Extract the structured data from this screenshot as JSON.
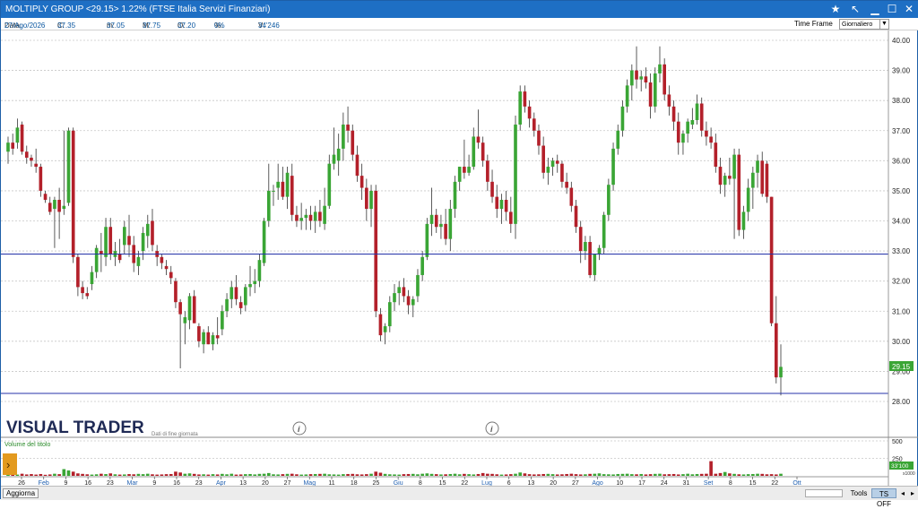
{
  "window": {
    "title": "MOLTIPLY GROUP <29.15> 1.22% (FTSE Italia Servizi Finanziari)",
    "star_icon": "star-icon",
    "pointer_icon": "arrow-pointer-icon"
  },
  "info": {
    "data_label": "Data:",
    "data_value": "27/Ago/2026",
    "c_label": "C:",
    "c_value": "37.35",
    "m_label": "m:",
    "m_value": "37.05",
    "M_label": "M:",
    "M_value": "37.75",
    "o_label": "O:",
    "o_value": "37.20",
    "pct_label": "%:",
    "pct_value": "0%",
    "v_label": "V:",
    "v_value": "34'246"
  },
  "timeframe": {
    "label": "Time Frame",
    "selected": "Giornaliero"
  },
  "chart": {
    "logo": "VISUAL TRADER",
    "logo_sub": "Dati di fine giornata",
    "volume_title": "Volume del titolo",
    "last_price_tag": "29.15",
    "volume_tag": "33'100",
    "volume_unit": "x1000"
  },
  "bottom": {
    "refresh": "Aggiorna",
    "tools": "Tools",
    "tsoff": "TS OFF"
  },
  "colors": {
    "up": "#3aa535",
    "down": "#b3202a",
    "reference_line": "#2433a8",
    "titlebar": "#1e6fc4"
  },
  "chart_data": {
    "type": "candlestick",
    "y_axis_ticks": [
      "28.00",
      "29.00",
      "30.00",
      "31.00",
      "32.00",
      "33.00",
      "34.00",
      "35.00",
      "36.00",
      "37.00",
      "38.00",
      "39.00",
      "40.00"
    ],
    "ylim": [
      28,
      40.1
    ],
    "reference_line": 32.9,
    "volume_ticks": [
      "250",
      "500"
    ],
    "x_tick_labels": [
      "26",
      "Feb",
      "9",
      "16",
      "23",
      "Mar",
      "9",
      "16",
      "23",
      "Apr",
      "13",
      "20",
      "27",
      "Mag",
      "11",
      "18",
      "25",
      "Giu",
      "8",
      "15",
      "22",
      "Lug",
      "6",
      "13",
      "20",
      "27",
      "Ago",
      "10",
      "17",
      "24",
      "31",
      "Set",
      "8",
      "15",
      "22",
      "Ott"
    ],
    "ohlc": [
      {
        "o": 36.3,
        "h": 36.8,
        "l": 35.9,
        "c": 36.6
      },
      {
        "o": 36.6,
        "h": 36.9,
        "l": 36.2,
        "c": 36.4
      },
      {
        "o": 36.6,
        "h": 37.4,
        "l": 36.4,
        "c": 37.1
      },
      {
        "o": 37.2,
        "h": 37.3,
        "l": 36.2,
        "c": 36.3
      },
      {
        "o": 36.3,
        "h": 36.5,
        "l": 35.9,
        "c": 36.1
      },
      {
        "o": 36.1,
        "h": 36.2,
        "l": 35.8,
        "c": 36.0
      },
      {
        "o": 35.9,
        "h": 36.4,
        "l": 35.6,
        "c": 35.8
      },
      {
        "o": 35.8,
        "h": 35.9,
        "l": 34.8,
        "c": 35.0
      },
      {
        "o": 34.9,
        "h": 35.0,
        "l": 34.6,
        "c": 34.7
      },
      {
        "o": 34.6,
        "h": 34.8,
        "l": 34.2,
        "c": 34.3
      },
      {
        "o": 34.4,
        "h": 34.8,
        "l": 33.1,
        "c": 34.7
      },
      {
        "o": 34.7,
        "h": 35.1,
        "l": 33.4,
        "c": 34.3
      },
      {
        "o": 34.4,
        "h": 37.0,
        "l": 34.2,
        "c": 34.5
      },
      {
        "o": 34.6,
        "h": 37.1,
        "l": 34.5,
        "c": 37.0
      },
      {
        "o": 37.0,
        "h": 37.1,
        "l": 32.6,
        "c": 32.8
      },
      {
        "o": 32.8,
        "h": 32.9,
        "l": 31.5,
        "c": 31.8
      },
      {
        "o": 31.8,
        "h": 32.0,
        "l": 31.4,
        "c": 31.6
      },
      {
        "o": 31.6,
        "h": 31.8,
        "l": 31.4,
        "c": 31.5
      },
      {
        "o": 31.9,
        "h": 32.5,
        "l": 31.7,
        "c": 32.3
      },
      {
        "o": 32.3,
        "h": 33.2,
        "l": 32.1,
        "c": 33.1
      },
      {
        "o": 33.0,
        "h": 33.6,
        "l": 32.3,
        "c": 32.9
      },
      {
        "o": 32.8,
        "h": 34.1,
        "l": 32.5,
        "c": 33.8
      },
      {
        "o": 33.8,
        "h": 34.1,
        "l": 32.7,
        "c": 32.9
      },
      {
        "o": 32.8,
        "h": 33.3,
        "l": 32.5,
        "c": 33.0
      },
      {
        "o": 32.9,
        "h": 33.4,
        "l": 32.6,
        "c": 32.7
      },
      {
        "o": 33.2,
        "h": 34.0,
        "l": 32.9,
        "c": 33.8
      },
      {
        "o": 33.5,
        "h": 34.2,
        "l": 32.8,
        "c": 33.2
      },
      {
        "o": 33.2,
        "h": 33.5,
        "l": 32.3,
        "c": 32.6
      },
      {
        "o": 32.5,
        "h": 33.0,
        "l": 32.2,
        "c": 32.8
      },
      {
        "o": 33.0,
        "h": 33.8,
        "l": 32.7,
        "c": 33.6
      },
      {
        "o": 33.5,
        "h": 34.2,
        "l": 33.1,
        "c": 33.9
      },
      {
        "o": 34.0,
        "h": 34.4,
        "l": 33.0,
        "c": 33.2
      },
      {
        "o": 33.0,
        "h": 33.2,
        "l": 32.5,
        "c": 32.8
      },
      {
        "o": 32.8,
        "h": 32.9,
        "l": 32.4,
        "c": 32.6
      },
      {
        "o": 32.5,
        "h": 32.7,
        "l": 32.2,
        "c": 32.4
      },
      {
        "o": 32.3,
        "h": 32.5,
        "l": 31.9,
        "c": 32.1
      },
      {
        "o": 32.0,
        "h": 32.1,
        "l": 31.1,
        "c": 31.3
      },
      {
        "o": 31.3,
        "h": 31.4,
        "l": 29.1,
        "c": 30.9
      },
      {
        "o": 30.6,
        "h": 31.0,
        "l": 29.9,
        "c": 30.8
      },
      {
        "o": 30.7,
        "h": 31.6,
        "l": 30.4,
        "c": 31.5
      },
      {
        "o": 31.5,
        "h": 31.7,
        "l": 30.6,
        "c": 30.6
      },
      {
        "o": 30.5,
        "h": 30.6,
        "l": 29.8,
        "c": 30.0
      },
      {
        "o": 29.9,
        "h": 30.4,
        "l": 29.6,
        "c": 30.3
      },
      {
        "o": 30.3,
        "h": 30.5,
        "l": 29.9,
        "c": 29.9
      },
      {
        "o": 29.9,
        "h": 30.3,
        "l": 29.7,
        "c": 30.2
      },
      {
        "o": 30.2,
        "h": 30.8,
        "l": 29.9,
        "c": 30.1
      },
      {
        "o": 30.4,
        "h": 31.2,
        "l": 30.2,
        "c": 31.0
      },
      {
        "o": 31.0,
        "h": 31.6,
        "l": 30.8,
        "c": 31.4
      },
      {
        "o": 31.4,
        "h": 32.0,
        "l": 31.1,
        "c": 31.8
      },
      {
        "o": 31.8,
        "h": 32.2,
        "l": 31.2,
        "c": 31.4
      },
      {
        "o": 31.3,
        "h": 31.5,
        "l": 30.9,
        "c": 31.1
      },
      {
        "o": 31.2,
        "h": 31.9,
        "l": 31.0,
        "c": 31.8
      },
      {
        "o": 31.8,
        "h": 32.5,
        "l": 31.5,
        "c": 31.9
      },
      {
        "o": 31.9,
        "h": 32.4,
        "l": 31.6,
        "c": 32.0
      },
      {
        "o": 32.0,
        "h": 32.9,
        "l": 31.8,
        "c": 32.7
      },
      {
        "o": 32.6,
        "h": 34.1,
        "l": 32.5,
        "c": 34.0
      },
      {
        "o": 34.0,
        "h": 35.9,
        "l": 33.8,
        "c": 35.0
      },
      {
        "o": 35.0,
        "h": 35.2,
        "l": 34.5,
        "c": 35.0
      },
      {
        "o": 35.1,
        "h": 35.9,
        "l": 34.7,
        "c": 35.3
      },
      {
        "o": 35.3,
        "h": 35.8,
        "l": 34.7,
        "c": 34.8
      },
      {
        "o": 34.8,
        "h": 35.8,
        "l": 34.4,
        "c": 35.6
      },
      {
        "o": 35.5,
        "h": 35.9,
        "l": 34.0,
        "c": 34.2
      },
      {
        "o": 34.2,
        "h": 34.5,
        "l": 33.8,
        "c": 34.0
      },
      {
        "o": 34.0,
        "h": 34.6,
        "l": 33.7,
        "c": 34.1
      },
      {
        "o": 34.1,
        "h": 34.4,
        "l": 33.7,
        "c": 34.2
      },
      {
        "o": 34.2,
        "h": 34.5,
        "l": 33.7,
        "c": 34.0
      },
      {
        "o": 34.0,
        "h": 34.5,
        "l": 33.6,
        "c": 34.3
      },
      {
        "o": 34.3,
        "h": 34.7,
        "l": 33.8,
        "c": 34.0
      },
      {
        "o": 33.9,
        "h": 35.1,
        "l": 33.7,
        "c": 34.5
      },
      {
        "o": 34.5,
        "h": 36.2,
        "l": 34.4,
        "c": 35.9
      },
      {
        "o": 35.9,
        "h": 37.1,
        "l": 35.7,
        "c": 36.2
      },
      {
        "o": 36.0,
        "h": 36.9,
        "l": 35.5,
        "c": 36.4
      },
      {
        "o": 36.4,
        "h": 37.6,
        "l": 36.0,
        "c": 37.2
      },
      {
        "o": 37.2,
        "h": 37.8,
        "l": 36.6,
        "c": 37.0
      },
      {
        "o": 37.0,
        "h": 37.2,
        "l": 36.0,
        "c": 36.2
      },
      {
        "o": 36.2,
        "h": 36.5,
        "l": 35.3,
        "c": 35.5
      },
      {
        "o": 35.5,
        "h": 35.9,
        "l": 34.7,
        "c": 35.1
      },
      {
        "o": 35.1,
        "h": 35.4,
        "l": 34.0,
        "c": 34.4
      },
      {
        "o": 34.4,
        "h": 35.2,
        "l": 33.8,
        "c": 35.0
      },
      {
        "o": 35.0,
        "h": 35.2,
        "l": 30.8,
        "c": 31.0
      },
      {
        "o": 30.9,
        "h": 31.1,
        "l": 30.0,
        "c": 30.2
      },
      {
        "o": 30.3,
        "h": 30.6,
        "l": 29.9,
        "c": 30.5
      },
      {
        "o": 30.5,
        "h": 31.5,
        "l": 30.3,
        "c": 31.3
      },
      {
        "o": 31.3,
        "h": 31.9,
        "l": 31.0,
        "c": 31.6
      },
      {
        "o": 31.6,
        "h": 32.0,
        "l": 31.2,
        "c": 31.8
      },
      {
        "o": 31.8,
        "h": 32.1,
        "l": 31.3,
        "c": 31.5
      },
      {
        "o": 31.5,
        "h": 31.7,
        "l": 30.9,
        "c": 31.2
      },
      {
        "o": 31.2,
        "h": 31.5,
        "l": 30.8,
        "c": 31.4
      },
      {
        "o": 31.5,
        "h": 32.4,
        "l": 31.3,
        "c": 32.2
      },
      {
        "o": 32.2,
        "h": 33.0,
        "l": 32.0,
        "c": 32.8
      },
      {
        "o": 32.8,
        "h": 34.1,
        "l": 32.7,
        "c": 33.9
      },
      {
        "o": 33.9,
        "h": 35.1,
        "l": 33.5,
        "c": 34.2
      },
      {
        "o": 34.2,
        "h": 34.4,
        "l": 33.6,
        "c": 33.8
      },
      {
        "o": 33.8,
        "h": 34.2,
        "l": 33.4,
        "c": 33.9
      },
      {
        "o": 33.9,
        "h": 34.4,
        "l": 33.2,
        "c": 33.4
      },
      {
        "o": 33.4,
        "h": 34.7,
        "l": 33.0,
        "c": 34.4
      },
      {
        "o": 34.4,
        "h": 35.5,
        "l": 34.1,
        "c": 35.3
      },
      {
        "o": 35.3,
        "h": 35.8,
        "l": 35.0,
        "c": 35.8
      },
      {
        "o": 35.8,
        "h": 36.7,
        "l": 35.4,
        "c": 35.6
      },
      {
        "o": 35.6,
        "h": 36.2,
        "l": 35.5,
        "c": 35.8
      },
      {
        "o": 35.8,
        "h": 37.1,
        "l": 35.7,
        "c": 36.8
      },
      {
        "o": 36.8,
        "h": 37.7,
        "l": 36.4,
        "c": 36.6
      },
      {
        "o": 36.6,
        "h": 36.8,
        "l": 35.8,
        "c": 36.0
      },
      {
        "o": 36.0,
        "h": 36.2,
        "l": 35.0,
        "c": 35.3
      },
      {
        "o": 35.3,
        "h": 35.7,
        "l": 34.6,
        "c": 34.8
      },
      {
        "o": 34.8,
        "h": 35.2,
        "l": 34.1,
        "c": 34.4
      },
      {
        "o": 34.4,
        "h": 34.9,
        "l": 33.9,
        "c": 34.7
      },
      {
        "o": 34.7,
        "h": 35.0,
        "l": 34.0,
        "c": 34.3
      },
      {
        "o": 34.3,
        "h": 34.8,
        "l": 33.6,
        "c": 33.9
      },
      {
        "o": 33.9,
        "h": 37.5,
        "l": 33.4,
        "c": 37.2
      },
      {
        "o": 37.2,
        "h": 38.5,
        "l": 37.0,
        "c": 38.3
      },
      {
        "o": 38.3,
        "h": 38.5,
        "l": 37.6,
        "c": 37.8
      },
      {
        "o": 37.8,
        "h": 38.0,
        "l": 37.1,
        "c": 37.4
      },
      {
        "o": 37.4,
        "h": 37.6,
        "l": 36.8,
        "c": 37.0
      },
      {
        "o": 37.0,
        "h": 37.2,
        "l": 36.2,
        "c": 36.5
      },
      {
        "o": 36.5,
        "h": 36.8,
        "l": 35.4,
        "c": 35.6
      },
      {
        "o": 35.6,
        "h": 36.1,
        "l": 35.2,
        "c": 35.8
      },
      {
        "o": 35.8,
        "h": 36.1,
        "l": 35.5,
        "c": 36.0
      },
      {
        "o": 36.0,
        "h": 36.2,
        "l": 35.6,
        "c": 35.9
      },
      {
        "o": 35.9,
        "h": 36.0,
        "l": 35.1,
        "c": 35.3
      },
      {
        "o": 35.3,
        "h": 35.6,
        "l": 34.9,
        "c": 35.1
      },
      {
        "o": 35.1,
        "h": 35.3,
        "l": 34.3,
        "c": 34.5
      },
      {
        "o": 34.5,
        "h": 34.7,
        "l": 33.6,
        "c": 33.8
      },
      {
        "o": 33.8,
        "h": 34.0,
        "l": 32.6,
        "c": 33.0
      },
      {
        "o": 33.0,
        "h": 33.5,
        "l": 32.7,
        "c": 33.3
      },
      {
        "o": 33.3,
        "h": 33.5,
        "l": 32.1,
        "c": 32.2
      },
      {
        "o": 32.2,
        "h": 32.9,
        "l": 32.0,
        "c": 32.9
      },
      {
        "o": 32.9,
        "h": 33.2,
        "l": 32.7,
        "c": 33.1
      },
      {
        "o": 33.1,
        "h": 34.3,
        "l": 32.9,
        "c": 34.2
      },
      {
        "o": 34.2,
        "h": 35.4,
        "l": 34.0,
        "c": 35.2
      },
      {
        "o": 35.2,
        "h": 36.6,
        "l": 35.0,
        "c": 36.4
      },
      {
        "o": 36.4,
        "h": 37.2,
        "l": 36.2,
        "c": 37.0
      },
      {
        "o": 37.0,
        "h": 38.0,
        "l": 36.8,
        "c": 37.8
      },
      {
        "o": 37.8,
        "h": 38.7,
        "l": 37.6,
        "c": 38.5
      },
      {
        "o": 38.5,
        "h": 39.2,
        "l": 38.0,
        "c": 39.0
      },
      {
        "o": 39.0,
        "h": 39.8,
        "l": 38.4,
        "c": 38.7
      },
      {
        "o": 38.7,
        "h": 39.0,
        "l": 38.3,
        "c": 38.8
      },
      {
        "o": 38.8,
        "h": 39.1,
        "l": 38.4,
        "c": 38.6
      },
      {
        "o": 38.6,
        "h": 38.9,
        "l": 37.4,
        "c": 37.8
      },
      {
        "o": 37.8,
        "h": 39.1,
        "l": 37.6,
        "c": 38.9
      },
      {
        "o": 38.9,
        "h": 39.8,
        "l": 38.6,
        "c": 39.2
      },
      {
        "o": 39.2,
        "h": 39.4,
        "l": 38.0,
        "c": 38.2
      },
      {
        "o": 38.2,
        "h": 38.5,
        "l": 37.5,
        "c": 37.8
      },
      {
        "o": 37.8,
        "h": 38.0,
        "l": 37.0,
        "c": 37.3
      },
      {
        "o": 37.3,
        "h": 37.6,
        "l": 36.2,
        "c": 36.6
      },
      {
        "o": 36.6,
        "h": 37.0,
        "l": 36.2,
        "c": 36.9
      },
      {
        "o": 36.9,
        "h": 37.4,
        "l": 36.6,
        "c": 37.3
      },
      {
        "o": 37.2,
        "h": 37.75,
        "l": 37.05,
        "c": 37.35
      },
      {
        "o": 37.35,
        "h": 38.2,
        "l": 37.2,
        "c": 37.9
      },
      {
        "o": 37.9,
        "h": 38.1,
        "l": 36.8,
        "c": 37.0
      },
      {
        "o": 37.0,
        "h": 37.3,
        "l": 36.5,
        "c": 36.8
      },
      {
        "o": 36.8,
        "h": 37.1,
        "l": 36.4,
        "c": 36.6
      },
      {
        "o": 36.6,
        "h": 36.9,
        "l": 35.6,
        "c": 35.8
      },
      {
        "o": 35.8,
        "h": 36.1,
        "l": 34.9,
        "c": 35.2
      },
      {
        "o": 35.2,
        "h": 35.6,
        "l": 34.8,
        "c": 35.5
      },
      {
        "o": 35.5,
        "h": 36.1,
        "l": 35.2,
        "c": 35.4
      },
      {
        "o": 35.4,
        "h": 36.4,
        "l": 33.4,
        "c": 36.2
      },
      {
        "o": 36.2,
        "h": 36.4,
        "l": 33.5,
        "c": 33.7
      },
      {
        "o": 33.7,
        "h": 34.5,
        "l": 33.4,
        "c": 34.3
      },
      {
        "o": 34.3,
        "h": 35.4,
        "l": 34.0,
        "c": 35.1
      },
      {
        "o": 35.1,
        "h": 35.8,
        "l": 34.4,
        "c": 35.6
      },
      {
        "o": 35.6,
        "h": 36.2,
        "l": 35.1,
        "c": 36.0
      },
      {
        "o": 36.0,
        "h": 36.3,
        "l": 34.8,
        "c": 34.9
      },
      {
        "o": 35.9,
        "h": 36.0,
        "l": 34.6,
        "c": 34.8
      },
      {
        "o": 34.8,
        "h": 34.8,
        "l": 30.5,
        "c": 30.6
      },
      {
        "o": 30.6,
        "h": 31.5,
        "l": 28.6,
        "c": 28.8
      },
      {
        "o": 28.8,
        "h": 29.9,
        "l": 28.2,
        "c": 29.15
      }
    ],
    "volume": [
      40,
      22,
      18,
      30,
      20,
      25,
      18,
      26,
      15,
      20,
      30,
      24,
      96,
      78,
      60,
      35,
      28,
      22,
      18,
      22,
      30,
      25,
      35,
      22,
      18,
      20,
      25,
      22,
      28,
      24,
      30,
      22,
      18,
      20,
      24,
      26,
      60,
      48,
      30,
      35,
      28,
      20,
      22,
      18,
      24,
      20,
      28,
      22,
      30,
      18,
      20,
      24,
      26,
      20,
      28,
      30,
      40,
      22,
      20,
      24,
      28,
      30,
      22,
      18,
      20,
      24,
      26,
      28,
      30,
      22,
      20,
      18,
      24,
      26,
      28,
      22,
      20,
      24,
      30,
      60,
      45,
      28,
      22,
      20,
      18,
      24,
      26,
      28,
      22,
      30,
      35,
      28,
      24,
      20,
      22,
      26,
      30,
      22,
      28,
      24,
      20,
      26,
      40,
      30,
      28,
      22,
      18,
      20,
      24,
      30,
      48,
      35,
      24,
      20,
      22,
      26,
      28,
      24,
      20,
      22,
      26,
      30,
      24,
      20,
      22,
      28,
      30,
      35,
      24,
      22,
      20,
      26,
      28,
      30,
      24,
      22,
      26,
      20,
      24,
      28,
      30,
      22,
      24,
      26,
      20,
      24,
      30,
      22,
      26,
      28,
      30,
      210,
      30,
      40,
      55,
      35,
      28,
      22,
      20,
      24,
      26,
      30,
      28,
      22,
      24,
      20,
      30,
      28,
      90,
      70,
      45
    ]
  }
}
